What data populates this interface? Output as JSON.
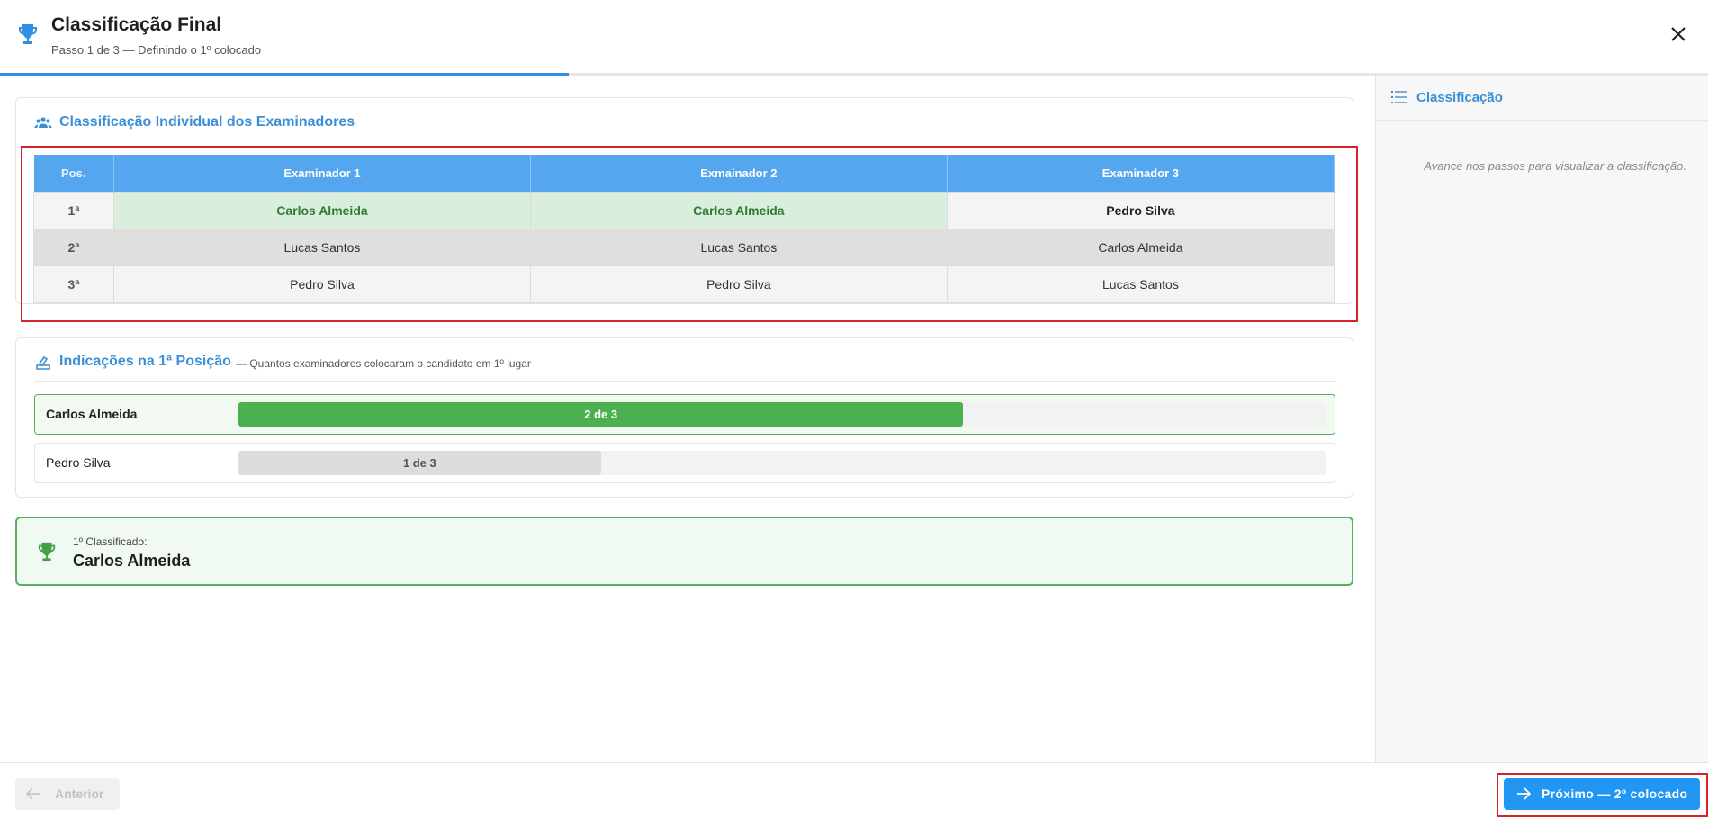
{
  "header": {
    "title": "Classificação Final",
    "subtitle": "Passo 1 de 3 — Definindo o 1º colocado",
    "progress_fraction": 0.333
  },
  "individual": {
    "title": "Classificação Individual dos Examinadores",
    "columns": [
      "Pos.",
      "Examinador 1",
      "Exmainador 2",
      "Examinador 3"
    ],
    "rows": [
      {
        "pos": "1ª",
        "cells": [
          "Carlos Almeida",
          "Carlos Almeida",
          "Pedro Silva"
        ]
      },
      {
        "pos": "2ª",
        "cells": [
          "Lucas Santos",
          "Lucas Santos",
          "Carlos Almeida"
        ]
      },
      {
        "pos": "3ª",
        "cells": [
          "Pedro Silva",
          "Pedro Silva",
          "Lucas Santos"
        ]
      }
    ]
  },
  "indications": {
    "title": "Indicações na 1ª Posição",
    "note": "— Quantos examinadores colocaram o candidato em 1º lugar",
    "items": [
      {
        "name": "Carlos Almeida",
        "label": "2 de 3",
        "fraction": 0.6667
      },
      {
        "name": "Pedro Silva",
        "label": "1 de 3",
        "fraction": 0.3333
      }
    ]
  },
  "result": {
    "label": "1º Classificado:",
    "value": "Carlos Almeida"
  },
  "side": {
    "title": "Classificação",
    "empty": "Avance nos passos para visualizar a classificação."
  },
  "footer": {
    "prev_label": "Anterior",
    "next_label": "Próximo — 2º colocado"
  },
  "colors": {
    "accent": "#2196f3",
    "header_blue": "#54a7ee",
    "success": "#4caf50",
    "highlight_red": "#d5232b"
  }
}
